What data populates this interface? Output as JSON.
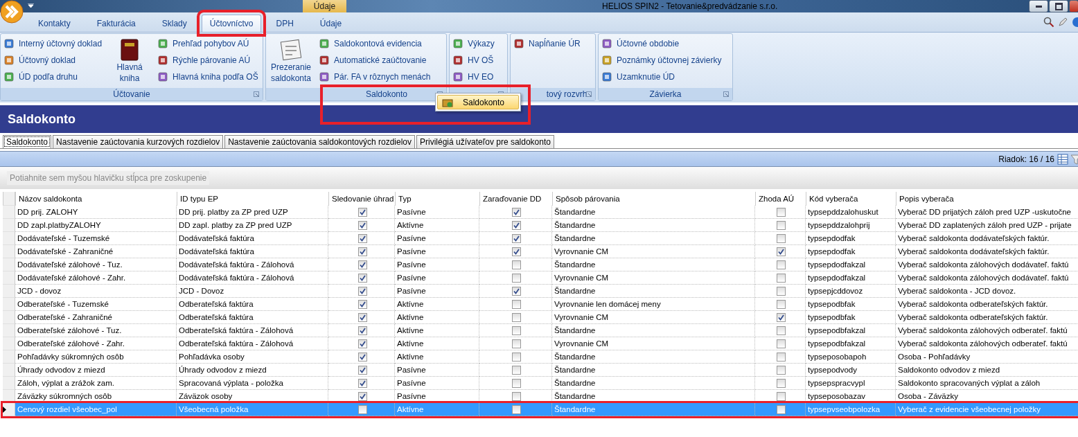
{
  "window": {
    "title": "HELIOS SPIN2 - Tetovanie&predvádzanie s.r.o.",
    "context_tab": "Údaje"
  },
  "ribbon_tabs": [
    {
      "label": "Kontakty",
      "selected": false,
      "highlighted": false
    },
    {
      "label": "Fakturácia",
      "selected": false,
      "highlighted": false
    },
    {
      "label": "Sklady",
      "selected": false,
      "highlighted": false
    },
    {
      "label": "Účtovníctvo",
      "selected": true,
      "highlighted": true
    },
    {
      "label": "DPH",
      "selected": false,
      "highlighted": false
    },
    {
      "label": "Údaje",
      "selected": false,
      "highlighted": false
    }
  ],
  "ribbon_groups": [
    {
      "label": "Účtovanie",
      "parts": [
        {
          "kind": "list",
          "items": [
            "Interný účtovný doklad",
            "Účtovný doklad",
            "ÚD podľa druhu"
          ]
        },
        {
          "kind": "large",
          "label": "Hlavná kniha"
        },
        {
          "kind": "list",
          "items": [
            "Prehľad pohybov AÚ",
            "Rýchle párovanie AÚ",
            "Hlavná kniha podľa OŠ"
          ]
        }
      ]
    },
    {
      "label": "Saldokonto",
      "parts": [
        {
          "kind": "large",
          "label": "Prezeranie saldokonta"
        },
        {
          "kind": "list",
          "items": [
            "Saldokontová evidencia",
            "Automatické zaúčtovanie",
            "Pár. FA v rôznych menách"
          ]
        }
      ]
    },
    {
      "parts": [
        {
          "kind": "list",
          "items": [
            "Výkazy",
            "HV OŠ",
            "HV EO"
          ]
        }
      ]
    },
    {
      "label": "tový rozvrh",
      "parts": [
        {
          "kind": "list",
          "items": [
            "Napĺňanie ÚR"
          ]
        }
      ]
    },
    {
      "label": "Závierka",
      "parts": [
        {
          "kind": "list",
          "items": [
            "Účtovné obdobie",
            "Poznámky účtovnej závierky",
            "Uzamknutie ÚD"
          ]
        }
      ]
    }
  ],
  "popup_menu": {
    "items": [
      "Saldokonto"
    ],
    "highlighted": true
  },
  "page_title": "Saldokonto",
  "tabs": [
    {
      "label": "Saldokonto",
      "selected": true
    },
    {
      "label": "Nastavenie zaúctovania kurzových rozdielov",
      "selected": false
    },
    {
      "label": "Nastavenie zaúctovania saldokontových rozdielov",
      "selected": false
    },
    {
      "label": "Privilégiá užívateľov pre saldokonto",
      "selected": false
    }
  ],
  "row_counter": "Riadok: 16 / 16",
  "group_panel": {
    "placeholder": "Potiahnite sem myšou hlavičku stĺpca pre zoskupenie"
  },
  "table": {
    "columns": [
      {
        "label": "Názov saldokonta",
        "kind": "text"
      },
      {
        "label": "ID typu EP",
        "kind": "text"
      },
      {
        "label": "Sledovanie úhrad",
        "kind": "check"
      },
      {
        "label": "Typ",
        "kind": "text"
      },
      {
        "label": "Zaraďovanie DD",
        "kind": "check"
      },
      {
        "label": "Spôsob párovania",
        "kind": "text"
      },
      {
        "label": "Zhoda AÚ",
        "kind": "check"
      },
      {
        "label": "Kód vyberača",
        "kind": "text"
      },
      {
        "label": "Popis vyberača",
        "kind": "text"
      }
    ],
    "rows": [
      {
        "selected": false,
        "highlighted": false,
        "cells": [
          "DD prij. ZALOHY",
          "DD prij. platby za ZP pred UZP",
          true,
          "Pasívne",
          true,
          "Štandardne",
          false,
          "typsepddzalohuskut",
          "Vyberač DD prijatých záloh pred UZP -uskutočne"
        ]
      },
      {
        "selected": false,
        "highlighted": false,
        "cells": [
          "DD zapl.platbyZALOHY",
          "DD zapl. platby za ZP pred UZP",
          true,
          "Aktívne",
          true,
          "Štandardne",
          false,
          "typsepddzalohprij",
          "Vyberač DD zaplatených záloh pred UZP - prijate"
        ]
      },
      {
        "selected": false,
        "highlighted": false,
        "cells": [
          "Dodávateľské - Tuzemské",
          "Dodávateľská faktúra",
          true,
          "Pasívne",
          true,
          "Štandardne",
          false,
          "typsepdodfak",
          "Vyberač saldokonta dodávateľských faktúr."
        ]
      },
      {
        "selected": false,
        "highlighted": false,
        "cells": [
          "Dodávateľské - Zahraničné",
          "Dodávateľská faktúra",
          true,
          "Pasívne",
          true,
          "Vyrovnanie CM",
          true,
          "typsepdodfak",
          "Vyberač saldokonta dodávateľských faktúr."
        ]
      },
      {
        "selected": false,
        "highlighted": false,
        "cells": [
          "Dodávateľské zálohové - Tuz.",
          "Dodávateľská faktúra - Zálohová",
          true,
          "Pasívne",
          false,
          "Štandardne",
          false,
          "typsepdodfakzal",
          "Vyberač saldokonta  zálohových dodávateľ. faktú"
        ]
      },
      {
        "selected": false,
        "highlighted": false,
        "cells": [
          "Dodávateľské zálohové - Zahr.",
          "Dodávateľská faktúra - Zálohová",
          true,
          "Pasívne",
          false,
          "Vyrovnanie CM",
          false,
          "typsepdodfakzal",
          "Vyberač saldokonta  zálohových dodávateľ. faktú"
        ]
      },
      {
        "selected": false,
        "highlighted": false,
        "cells": [
          "JCD - dovoz",
          "JCD - Dovoz",
          true,
          "Pasívne",
          true,
          "Štandardne",
          false,
          "typsepjcddovoz",
          "Vyberač saldokonta - JCD dovoz."
        ]
      },
      {
        "selected": false,
        "highlighted": false,
        "cells": [
          "Odberateľské - Tuzemské",
          "Odberateľská faktúra",
          true,
          "Aktívne",
          false,
          "Vyrovnanie len domácej meny",
          false,
          "typsepodbfak",
          "Vyberač saldokonta  odberateľských faktúr."
        ]
      },
      {
        "selected": false,
        "highlighted": false,
        "cells": [
          "Odberateľské - Zahraničné",
          "Odberateľská faktúra",
          true,
          "Aktívne",
          false,
          "Vyrovnanie CM",
          true,
          "typsepodbfak",
          "Vyberač saldokonta  odberateľských faktúr."
        ]
      },
      {
        "selected": false,
        "highlighted": false,
        "cells": [
          "Odberateľské zálohové - Tuz.",
          "Odberateľská faktúra - Zálohová",
          true,
          "Aktívne",
          false,
          "Štandardne",
          false,
          "typsepodbfakzal",
          "Vyberač saldokonta zálohových odberateľ. faktú"
        ]
      },
      {
        "selected": false,
        "highlighted": false,
        "cells": [
          "Odberateľské zálohové - Zahr.",
          "Odberateľská faktúra - Zálohová",
          true,
          "Aktívne",
          false,
          "Vyrovnanie CM",
          false,
          "typsepodbfakzal",
          "Vyberač saldokonta zálohových odberateľ. faktú"
        ]
      },
      {
        "selected": false,
        "highlighted": false,
        "cells": [
          "Pohľadávky súkromných osôb",
          "Pohľadávka osoby",
          true,
          "Aktívne",
          false,
          "Štandardne",
          false,
          "typseposobapoh",
          "Osoba - Pohľadávky"
        ]
      },
      {
        "selected": false,
        "highlighted": false,
        "cells": [
          "Úhrady odvodov z miezd",
          "Úhrady odvodov z miezd",
          true,
          "Pasívne",
          false,
          "Štandardne",
          false,
          "typsepodvody",
          "Saldokonto odvodov z miezd"
        ]
      },
      {
        "selected": false,
        "highlighted": false,
        "cells": [
          "Záloh, výplat a zrážok zam.",
          "Spracovaná výplata - položka",
          true,
          "Pasívne",
          false,
          "Štandardne",
          false,
          "typsepspracvypl",
          "Saldokonto spracovaných výplat a záloh"
        ]
      },
      {
        "selected": false,
        "highlighted": false,
        "cells": [
          "Záväzky súkromných osôb",
          "Záväzok osoby",
          true,
          "Pasívne",
          false,
          "Štandardne",
          false,
          "typseposobazav",
          "Osoba - Záväzky"
        ]
      },
      {
        "selected": true,
        "highlighted": true,
        "cells": [
          "Cenový rozdiel všeobec_pol",
          "Všeobecná položka",
          false,
          "Aktívne",
          false,
          "Štandardne",
          false,
          "typsepvseobpolozka",
          "Vyberač z evidencie všeobecnej položky"
        ]
      }
    ]
  }
}
